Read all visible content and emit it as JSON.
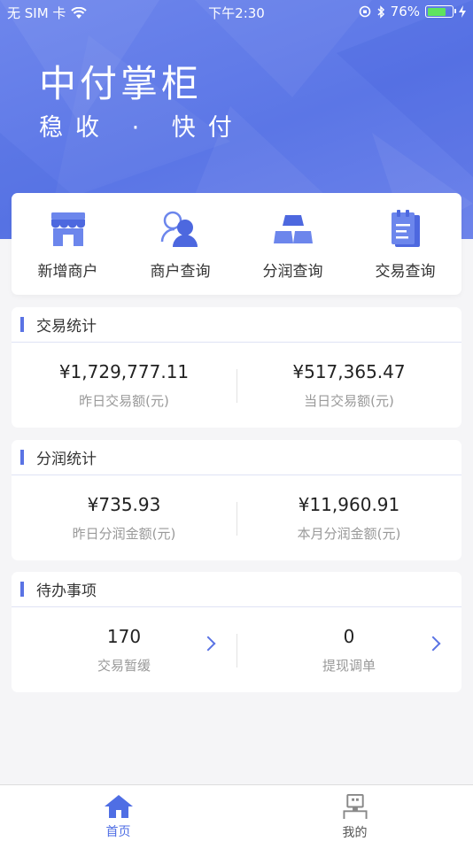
{
  "status_bar": {
    "carrier": "无 SIM 卡",
    "time": "下午2:30",
    "battery": "76%"
  },
  "hero": {
    "title": "中付掌柜",
    "slogan": "稳收 · 快付"
  },
  "quick_actions": [
    {
      "label": "新增商户",
      "icon": "store-icon"
    },
    {
      "label": "商户查询",
      "icon": "user-search-icon"
    },
    {
      "label": "分润查询",
      "icon": "gold-bars-icon"
    },
    {
      "label": "交易查询",
      "icon": "clipboard-icon"
    }
  ],
  "transaction_stats": {
    "title": "交易统计",
    "yesterday": {
      "value": "¥1,729,777.11",
      "label": "昨日交易额(元)"
    },
    "today": {
      "value": "¥517,365.47",
      "label": "当日交易额(元)"
    }
  },
  "profit_stats": {
    "title": "分润统计",
    "yesterday": {
      "value": "¥735.93",
      "label": "昨日分润金额(元)"
    },
    "month": {
      "value": "¥11,960.91",
      "label": "本月分润金额(元)"
    }
  },
  "todo": {
    "title": "待办事项",
    "deferred": {
      "value": "170",
      "label": "交易暂缓"
    },
    "adjust": {
      "value": "0",
      "label": "提现调单"
    }
  },
  "tabbar": {
    "home": {
      "label": "首页",
      "active_color": "#4f6ee4"
    },
    "mine": {
      "label": "我的",
      "color": "#555555"
    }
  },
  "colors": {
    "accent": "#5a73e4",
    "hero": "#6a82ea"
  }
}
